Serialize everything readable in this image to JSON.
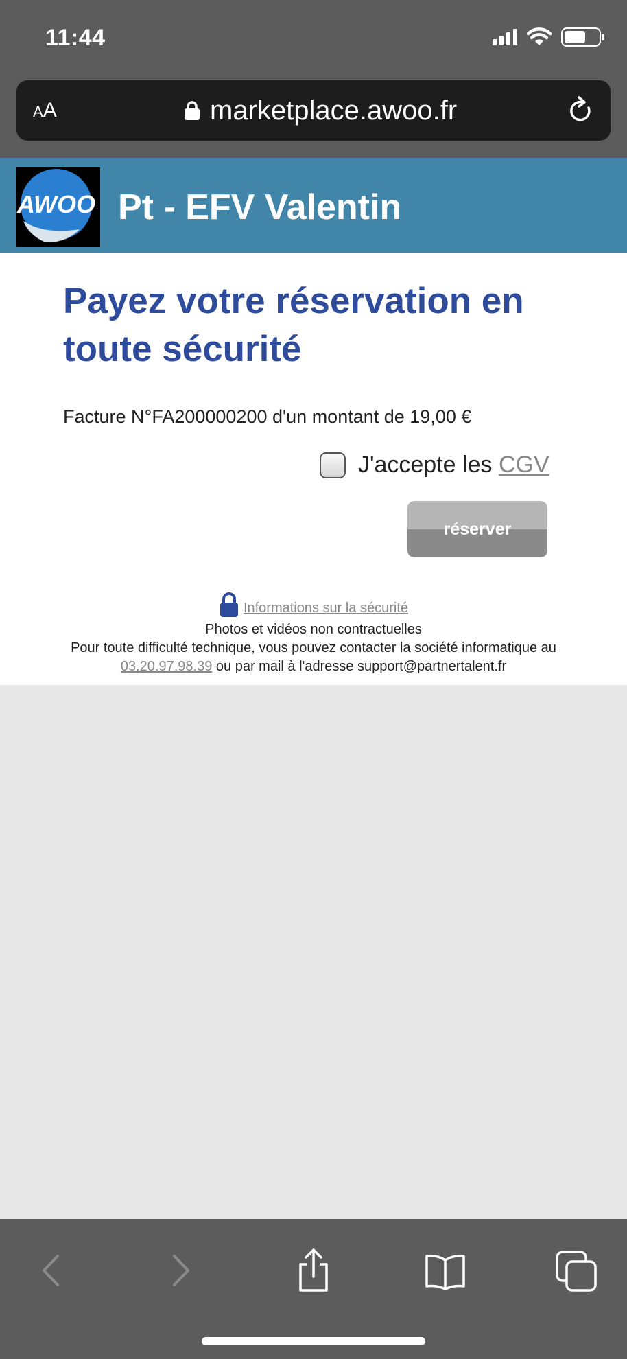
{
  "status_bar": {
    "time": "11:44"
  },
  "browser": {
    "text_size_label_small": "A",
    "text_size_label_large": "A",
    "url": "marketplace.awoo.fr"
  },
  "header": {
    "logo_text": "AWOO",
    "title": "Pt - EFV Valentin"
  },
  "main": {
    "headline": "Payez votre réservation en toute sécurité",
    "invoice_text": "Facture N°FA200000200 d'un montant de 19,00 €",
    "cgv_prefix": "J'accepte les",
    "cgv_link": "CGV",
    "cgv_checked": false,
    "reserve_button": "réserver"
  },
  "footer": {
    "security_link": "Informations sur la sécurité",
    "disclaimer": "Photos et vidéos non contractuelles",
    "support_line1": "Pour toute difficulté technique, vous pouvez contacter la société informatique au",
    "support_phone": "03.20.97.98.39",
    "support_line2_suffix": "ou par mail à l'adresse support@partnertalent.fr"
  },
  "colors": {
    "header_bg": "#4185a9",
    "headline": "#2f4c9c",
    "browser_chrome": "#5c5c5c"
  }
}
